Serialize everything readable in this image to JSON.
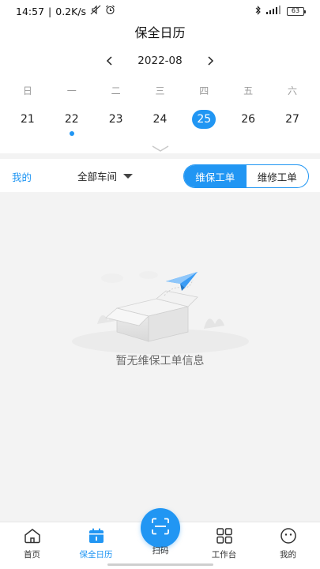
{
  "status_bar": {
    "time": "14:57",
    "speed": "0.2K/s",
    "battery": "63"
  },
  "page_title": "保全日历",
  "calendar": {
    "month": "2022-08",
    "weekdays": [
      "日",
      "一",
      "二",
      "三",
      "四",
      "五",
      "六"
    ],
    "days": [
      {
        "num": "21"
      },
      {
        "num": "22",
        "has_event": true
      },
      {
        "num": "23"
      },
      {
        "num": "24"
      },
      {
        "num": "25",
        "selected": true
      },
      {
        "num": "26"
      },
      {
        "num": "27"
      }
    ]
  },
  "filter": {
    "mine_label": "我的",
    "workshop_label": "全部车间",
    "segments": [
      {
        "label": "维保工单",
        "active": true
      },
      {
        "label": "维修工单"
      }
    ]
  },
  "empty_state": {
    "message": "暂无维保工单信息"
  },
  "tabbar": {
    "tabs": [
      {
        "label": "首页",
        "icon": "home-icon"
      },
      {
        "label": "保全日历",
        "icon": "calendar-icon",
        "active": true
      },
      {
        "label": "扫码",
        "icon": "scan-icon"
      },
      {
        "label": "工作台",
        "icon": "grid-icon"
      },
      {
        "label": "我的",
        "icon": "smile-icon"
      }
    ]
  },
  "colors": {
    "accent": "#2196f3",
    "background": "#f3f3f3"
  }
}
